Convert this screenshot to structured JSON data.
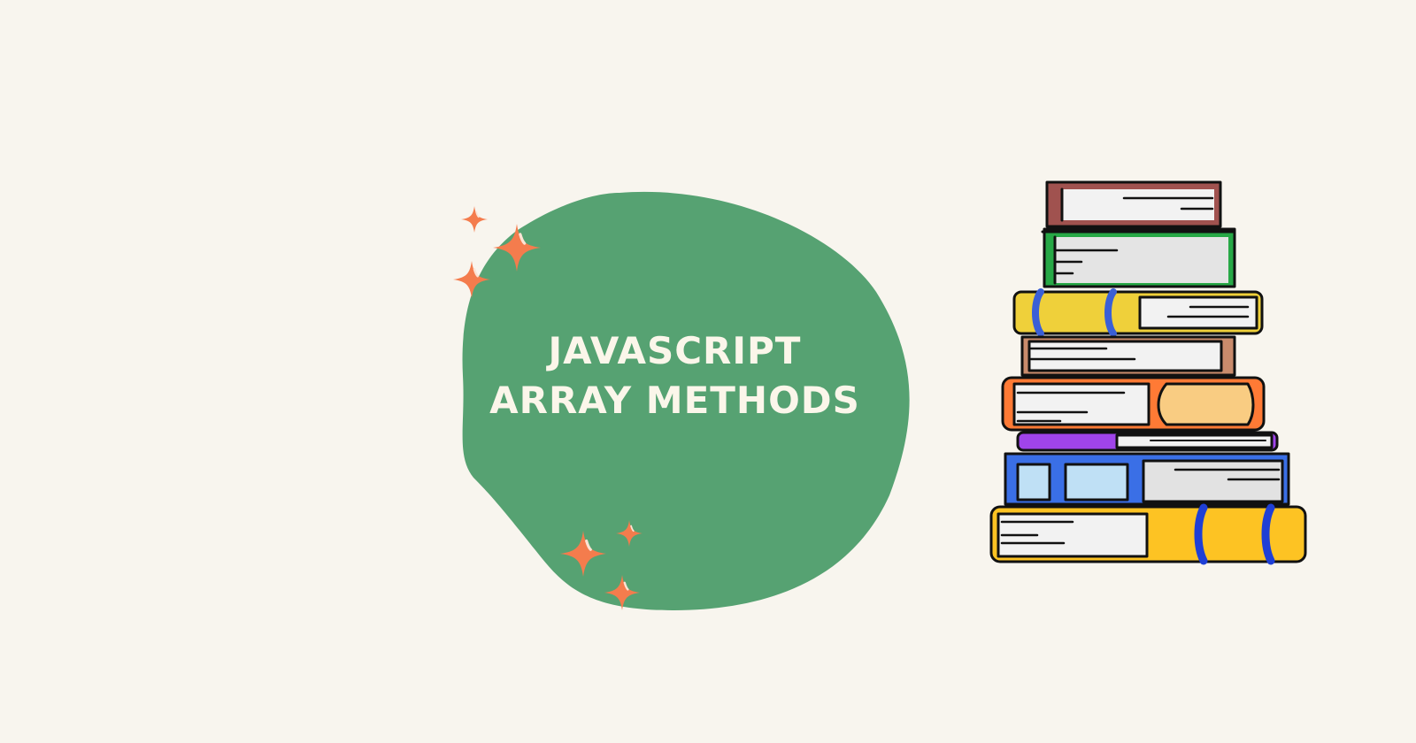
{
  "title": {
    "line1": "JAVASCRIPT",
    "line2": "ARRAY METHODS"
  },
  "colors": {
    "background": "#f8f5ee",
    "blob": "#56a272",
    "sparkle": "#f47c4d",
    "title_text": "#fbf6ea"
  },
  "icons": [
    "sparkle-icon",
    "book-stack-illustration"
  ]
}
